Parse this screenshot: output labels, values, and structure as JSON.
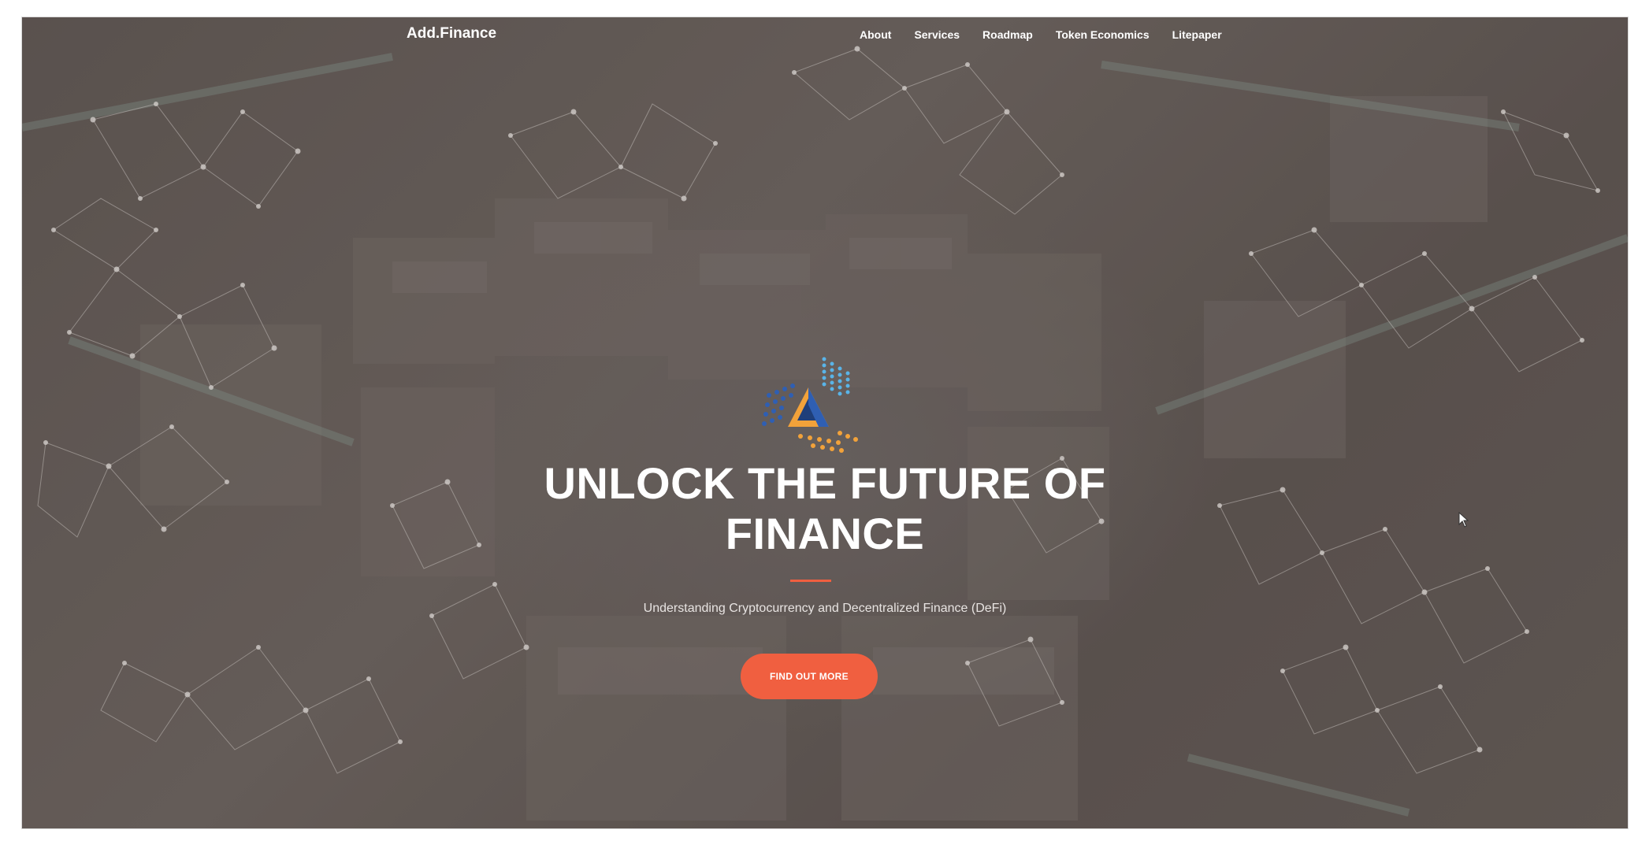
{
  "navbar": {
    "brand": "Add.Finance",
    "links": [
      {
        "label": "About"
      },
      {
        "label": "Services"
      },
      {
        "label": "Roadmap"
      },
      {
        "label": "Token Economics"
      },
      {
        "label": "Litepaper"
      }
    ]
  },
  "hero": {
    "logo_icon": "triangle-dots-logo-icon",
    "headline_line1": "UNLOCK THE FUTURE OF",
    "headline_line2": "FINANCE",
    "subtitle": "Understanding Cryptocurrency and Decentralized Finance (DeFi)",
    "cta_label": "FIND OUT MORE"
  },
  "colors": {
    "accent": "#f05f40",
    "overlay": "#675e5b",
    "text": "#ffffff",
    "logo_blue": "#2f5fb3",
    "logo_orange": "#f2a23a",
    "logo_cyan": "#59b4e8"
  },
  "icons": {
    "cursor": "mouse-pointer-icon",
    "background": "network-mesh-background"
  }
}
